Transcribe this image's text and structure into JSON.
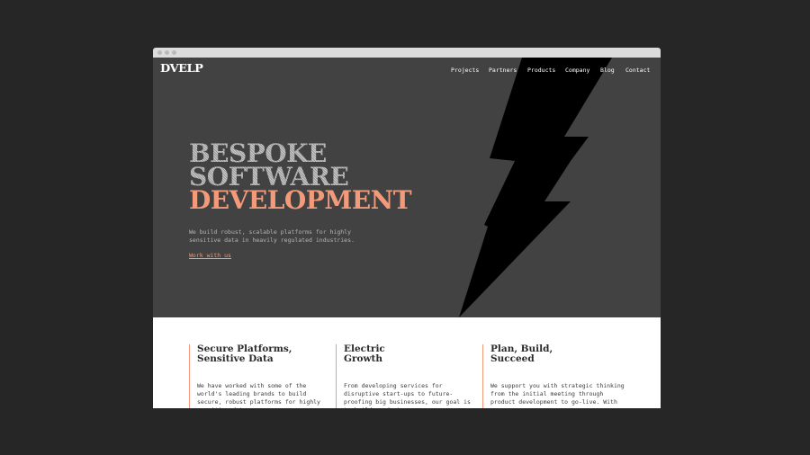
{
  "site": {
    "logo": "DVELP"
  },
  "nav": {
    "items": [
      {
        "label": "Projects"
      },
      {
        "label": "Partners"
      },
      {
        "label": "Products"
      },
      {
        "label": "Company"
      },
      {
        "label": "Blog"
      },
      {
        "label": "Contact"
      }
    ]
  },
  "hero": {
    "headline_line1": "BESPOKE",
    "headline_line2": "SOFTWARE",
    "headline_line3": "DEVELOPMENT",
    "tagline": "We build robust, scalable platforms for highly sensitive data in heavily regulated industries.",
    "cta": "Work with us"
  },
  "features": [
    {
      "title": "Secure Platforms, Sensitive Data",
      "body": "We have worked with some of the world's leading brands to build secure, robust platforms for highly sensitive data."
    },
    {
      "title": "Electric Growth",
      "body": "From developing services for disruptive start-ups to future-proofing big businesses, our goal is to build products"
    },
    {
      "title": "Plan, Build, Succeed",
      "body": "We support you with strategic thinking from the initial meeting through product development to go-live. With"
    }
  ],
  "colors": {
    "accent": "#f29a7a",
    "hero_background": "#424242",
    "page_background": "#262626"
  }
}
